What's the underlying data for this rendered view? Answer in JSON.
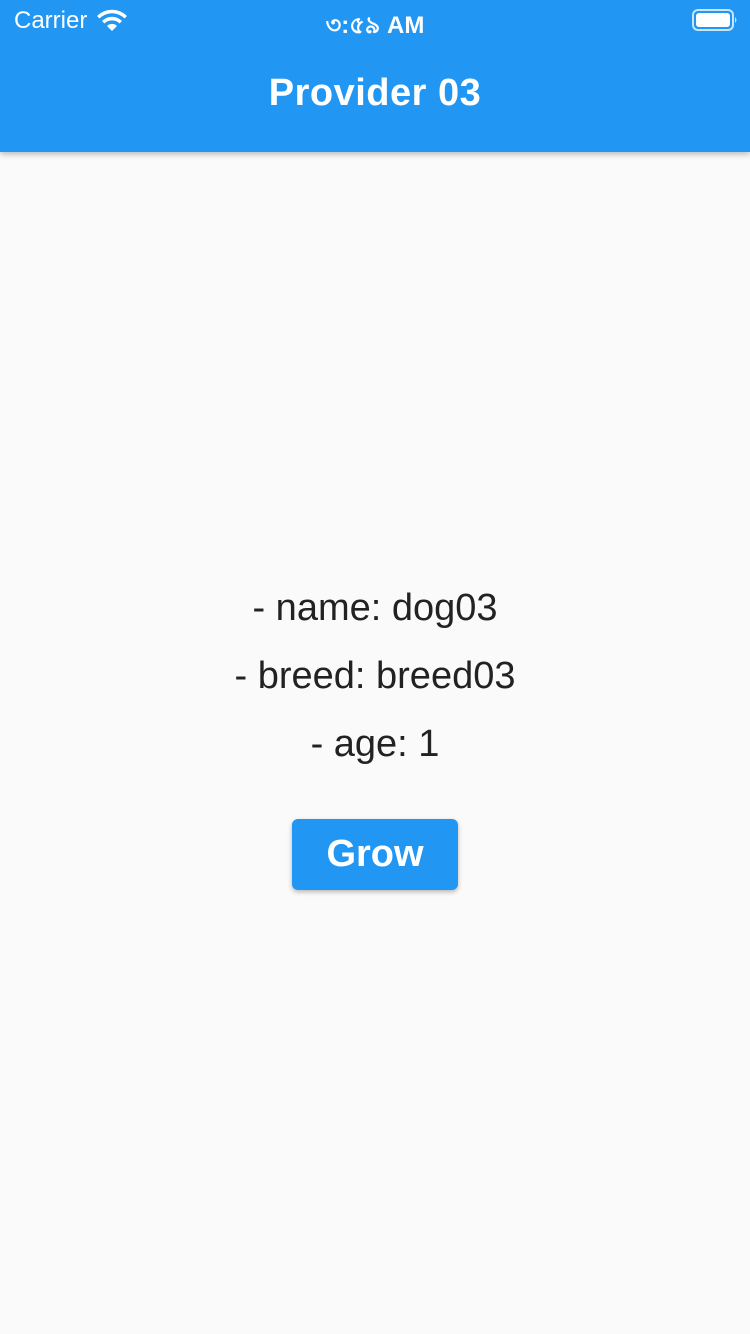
{
  "status_bar": {
    "carrier": "Carrier",
    "time": "৩:৫৯ AM",
    "icons": [
      "wifi-icon",
      "battery-icon"
    ]
  },
  "app_bar": {
    "title": "Provider 03",
    "color": "#2196f3"
  },
  "dog": {
    "name_line": "- name: dog03",
    "breed_line": "- breed: breed03",
    "age_line": "- age: 1"
  },
  "actions": {
    "grow_label": "Grow"
  },
  "colors": {
    "primary": "#2196f3",
    "background": "#fafafa",
    "text": "#222222"
  }
}
